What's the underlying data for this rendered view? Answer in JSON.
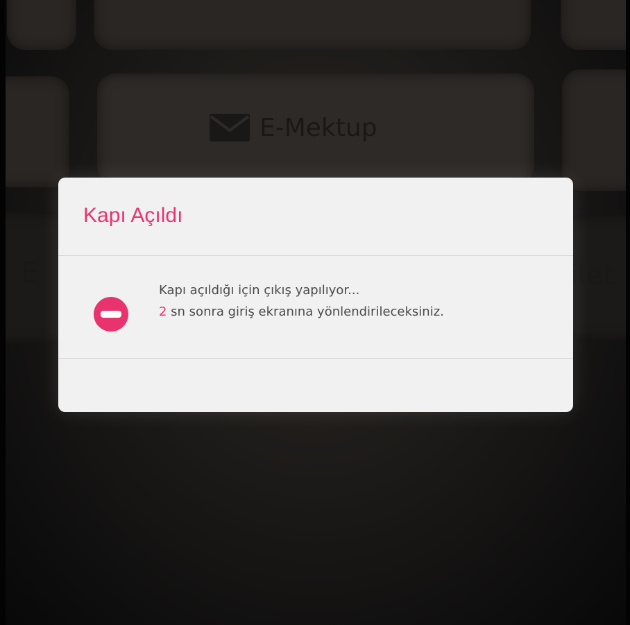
{
  "background": {
    "tile_label": "E-Mektup",
    "tile_icon": "envelope-icon",
    "left_partial_text": "E",
    "right_partial_text": "ilet"
  },
  "dialog": {
    "title": "Kapı Açıldı",
    "icon": "minus-circle-icon",
    "message_line1": "Kapı açıldığı için çıkış yapılıyor...",
    "countdown_value": "2",
    "message_line2_suffix": " sn sonra giriş ekranına yönlendirileceksiniz."
  },
  "colors": {
    "accent": "#e8336e",
    "dialog_background": "#f1f1f1",
    "text": "#4b4b4b"
  }
}
